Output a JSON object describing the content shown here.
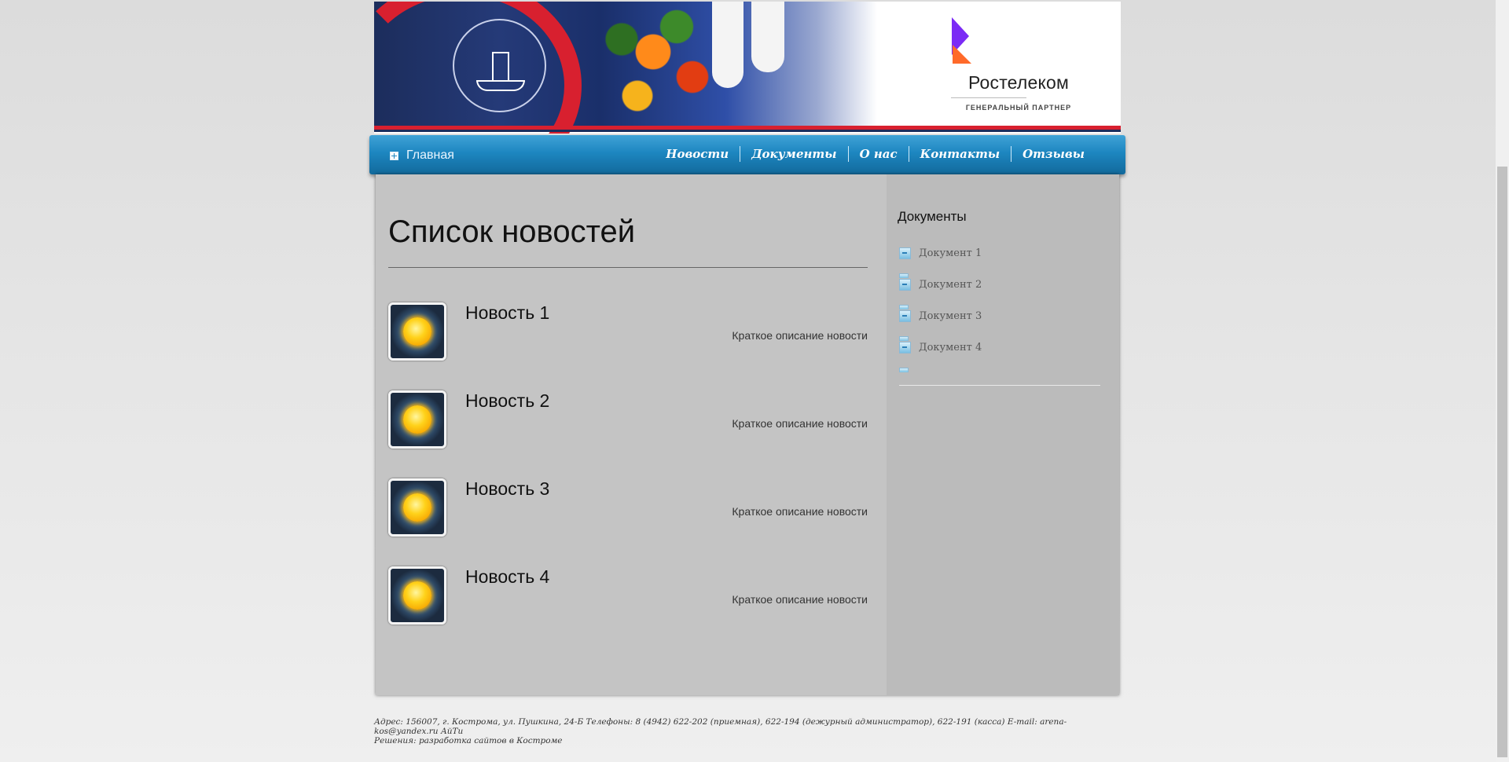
{
  "header": {
    "partner_name": "Ростелеком",
    "partner_role": "ГЕНЕРАЛЬНЫЙ ПАРТНЕР"
  },
  "nav": {
    "home_label": "Главная",
    "menu": [
      {
        "label": "Новости"
      },
      {
        "label": "Документы"
      },
      {
        "label": "О нас"
      },
      {
        "label": "Контакты"
      },
      {
        "label": "Отзывы"
      }
    ]
  },
  "main": {
    "title": "Список новостей",
    "news": [
      {
        "title": "Новость 1",
        "description": "Краткое описание новости"
      },
      {
        "title": "Новость 2",
        "description": "Краткое описание новости"
      },
      {
        "title": "Новость 3",
        "description": "Краткое описание новости"
      },
      {
        "title": "Новость 4",
        "description": "Краткое описание новости"
      }
    ]
  },
  "sidebar": {
    "title": "Документы",
    "documents": [
      {
        "label": "Документ 1"
      },
      {
        "label": "Документ 2"
      },
      {
        "label": "Документ 3"
      },
      {
        "label": "Документ 4"
      }
    ]
  },
  "footer": {
    "line1": "Адрес: 156007, г. Кострома, ул. Пушкина, 24-Б Телефоны: 8 (4942) 622-202 (приемная), 622-194 (дежурный администратор), 622-191 (касса) E-mail: arena-kos@yandex.ru АйТи",
    "line2": "Решения: разработка сайтов в Костроме"
  },
  "colors": {
    "nav_blue": "#1d86c0",
    "rostelecom_purple": "#7b2bf5",
    "rostelecom_orange": "#ff6a2a",
    "banner_red": "#d8202f"
  }
}
